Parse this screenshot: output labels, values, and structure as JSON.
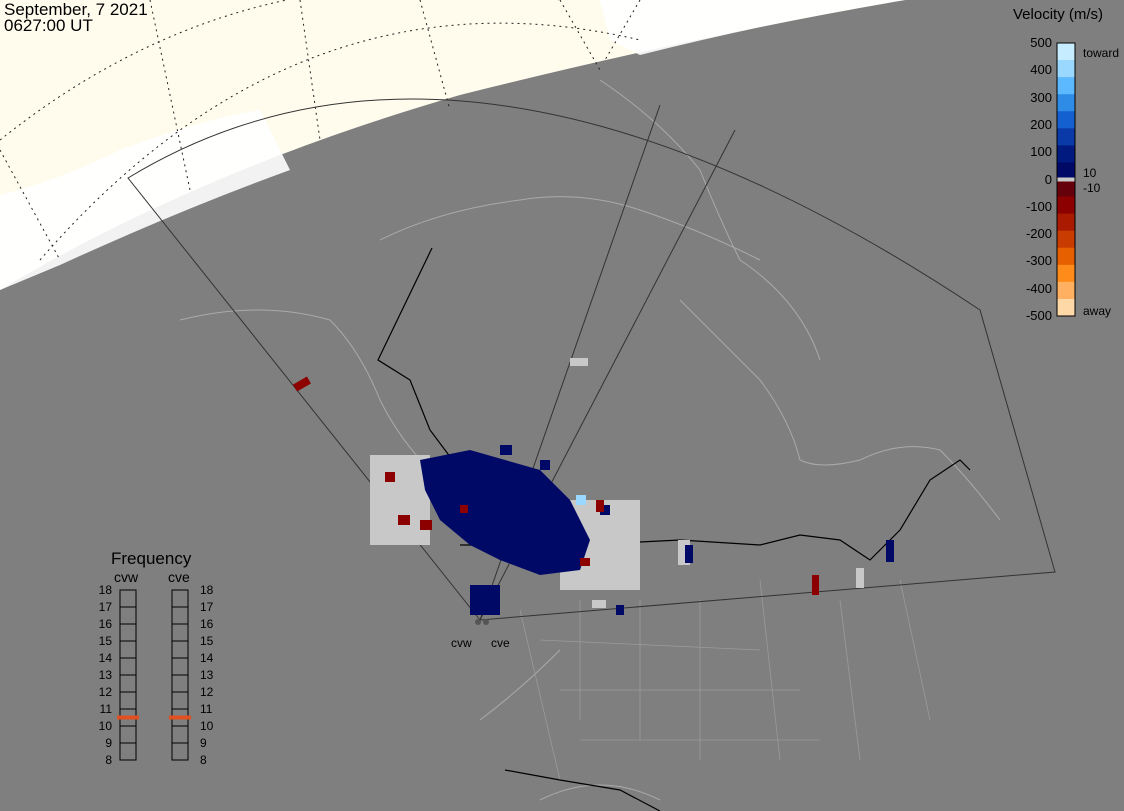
{
  "header": {
    "date": "September, 7 2021",
    "time": "0627:00 UT"
  },
  "colorbar": {
    "title": "Velocity (m/s)",
    "ticks": [
      "500",
      "400",
      "300",
      "200",
      "100",
      "0",
      "-100",
      "-200",
      "-300",
      "-400",
      "-500"
    ],
    "toward_label": "toward",
    "away_label": "away",
    "pos_threshold": "10",
    "neg_threshold": "-10",
    "colors": [
      "#c6ecff",
      "#9ad8ff",
      "#5cb8ff",
      "#2e8ce6",
      "#1560d0",
      "#0a3aa8",
      "#001a80",
      "#000a66",
      "#66000a",
      "#8c0000",
      "#aa1a00",
      "#c83c00",
      "#e66000",
      "#ff8c1a",
      "#ffb060",
      "#ffd8a8"
    ],
    "ground_scatter_color": "#c8c8c8"
  },
  "frequency": {
    "title": "Frequency",
    "radars": [
      {
        "name": "cvw",
        "value_mhz": 10.5
      },
      {
        "name": "cve",
        "value_mhz": 10.5
      }
    ],
    "scale": [
      "18",
      "17",
      "16",
      "15",
      "14",
      "13",
      "12",
      "11",
      "10",
      "9",
      "8"
    ]
  },
  "sites": [
    "cvw",
    "cve"
  ],
  "map_colors": {
    "night": "#7f7f7f",
    "day": "#fffcee",
    "ocean_day": "#ffffff",
    "lines": "#aaaaaa"
  }
}
